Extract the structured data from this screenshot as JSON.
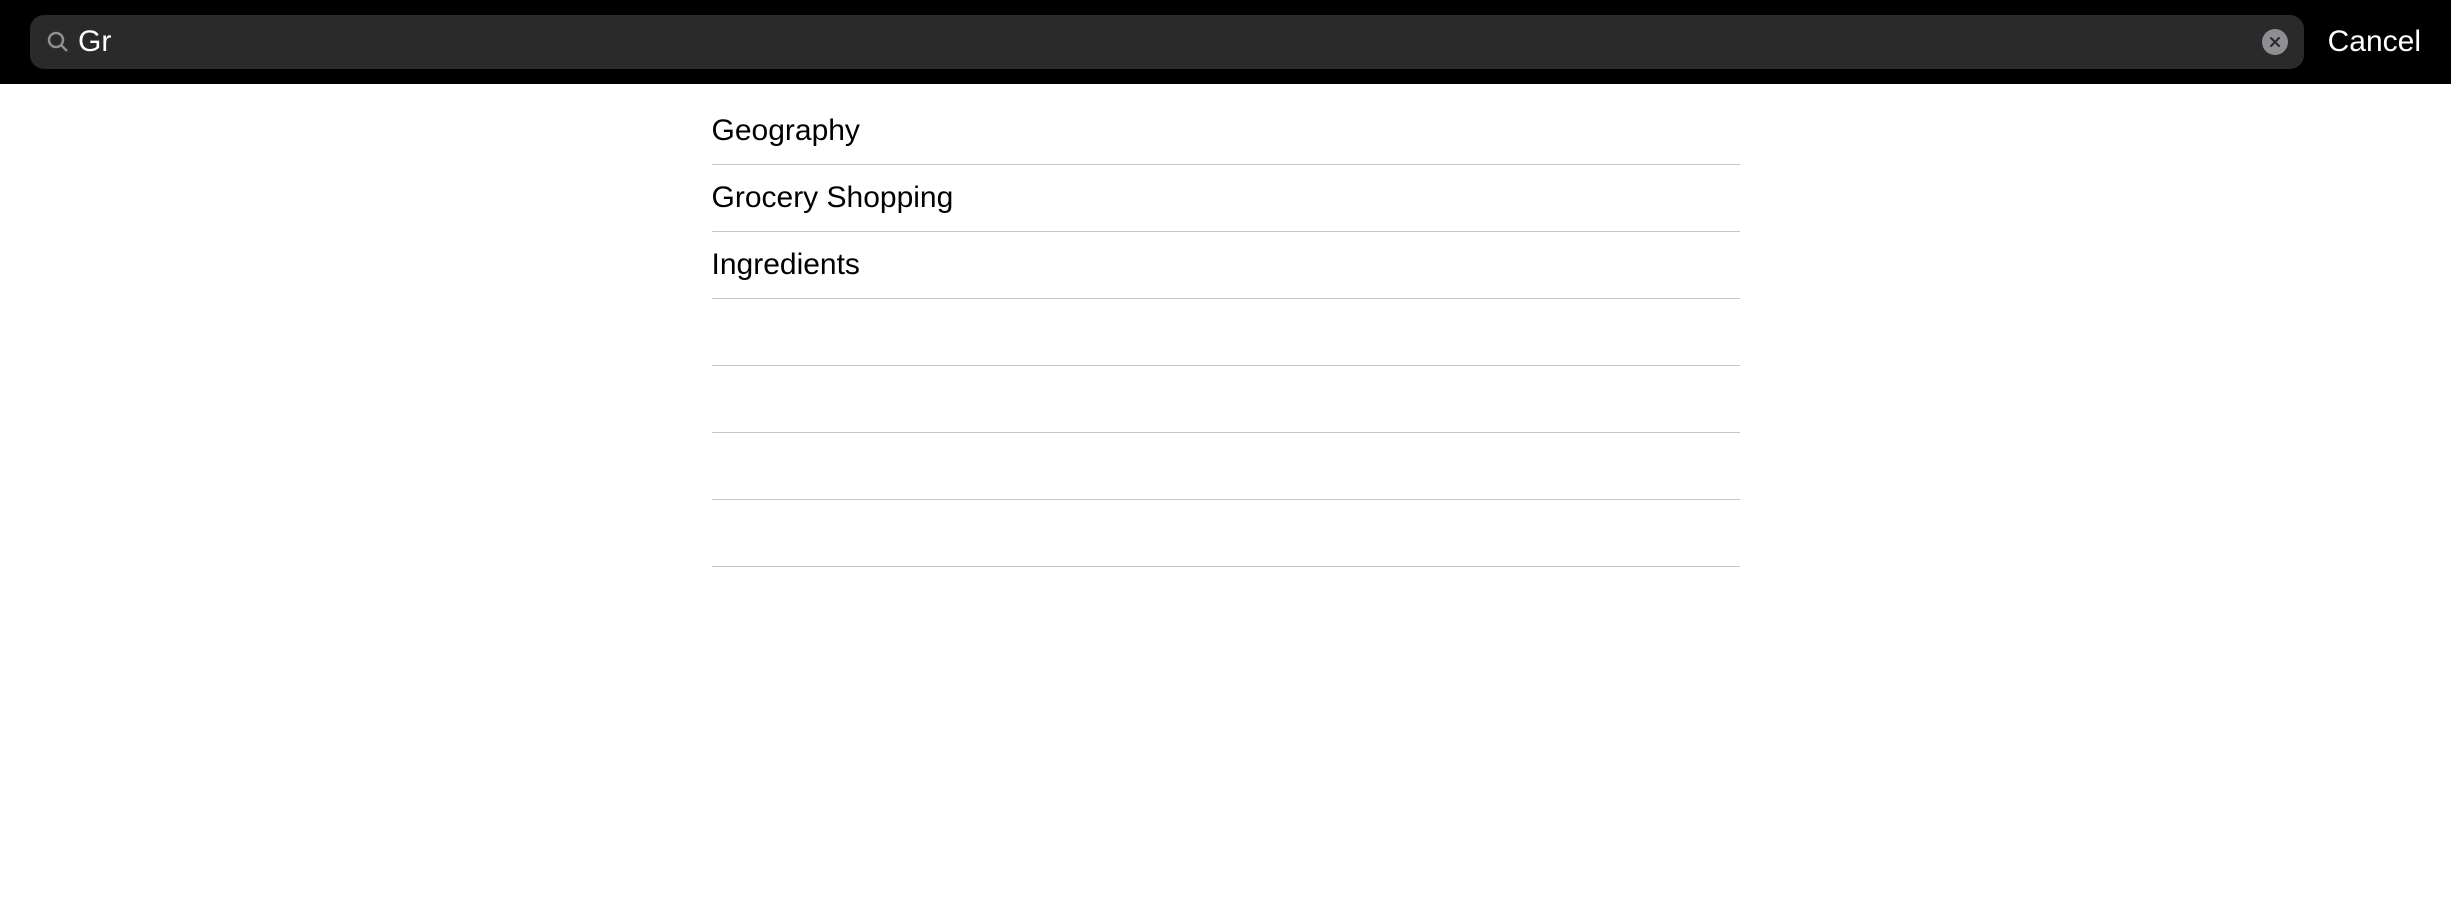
{
  "search": {
    "value": "Gr",
    "placeholder": "Search",
    "cancel_label": "Cancel"
  },
  "results": [
    {
      "label": "Geography"
    },
    {
      "label": "Grocery Shopping"
    },
    {
      "label": "Ingredients"
    }
  ],
  "empty_rows": 4
}
